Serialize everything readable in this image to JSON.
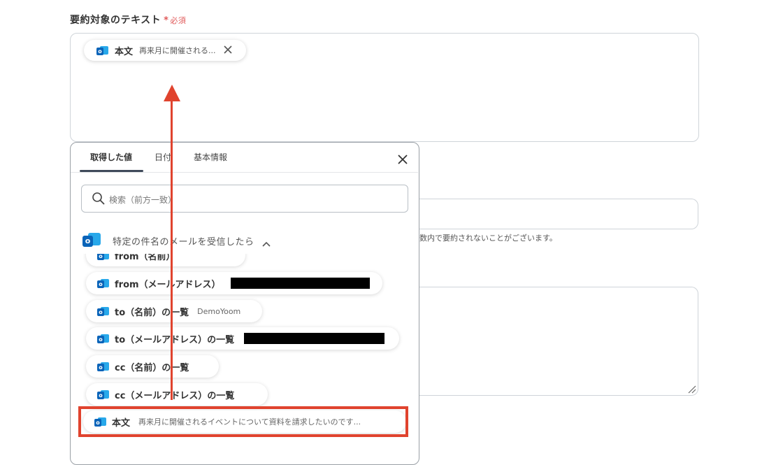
{
  "field": {
    "label": "要約対象のテキスト",
    "required_mark": "*",
    "required_text": "必須"
  },
  "top_chip": {
    "icon": "outlook-icon",
    "title": "本文",
    "value": "再来月に開催される..."
  },
  "background": {
    "note": "数内で要約されないことがございます。"
  },
  "panel": {
    "tabs": [
      {
        "label": "取得した値",
        "active": true
      },
      {
        "label": "日付",
        "active": false
      },
      {
        "label": "基本情報",
        "active": false
      }
    ],
    "search_placeholder": "検索（前方一致）",
    "group_title": "特定の件名のメールを受信したら",
    "items": [
      {
        "label": "from（名前）",
        "value": ""
      },
      {
        "label": "from（メールアドレス）",
        "value": "",
        "redacted": true
      },
      {
        "label": "to（名前）の一覧",
        "value": "DemoYoom"
      },
      {
        "label": "to（メールアドレス）の一覧",
        "value": "",
        "redacted": true
      },
      {
        "label": "cc（名前）の一覧",
        "value": ""
      },
      {
        "label": "cc（メールアドレス）の一覧",
        "value": ""
      },
      {
        "label": "本文",
        "value": "再来月に開催されるイベントについて資料を請求したいのです..."
      }
    ]
  },
  "colors": {
    "accent_red": "#e0432e",
    "required_red": "#e05a5a",
    "outlook_dark": "#0a64b9",
    "outlook_light": "#28a8ea"
  }
}
